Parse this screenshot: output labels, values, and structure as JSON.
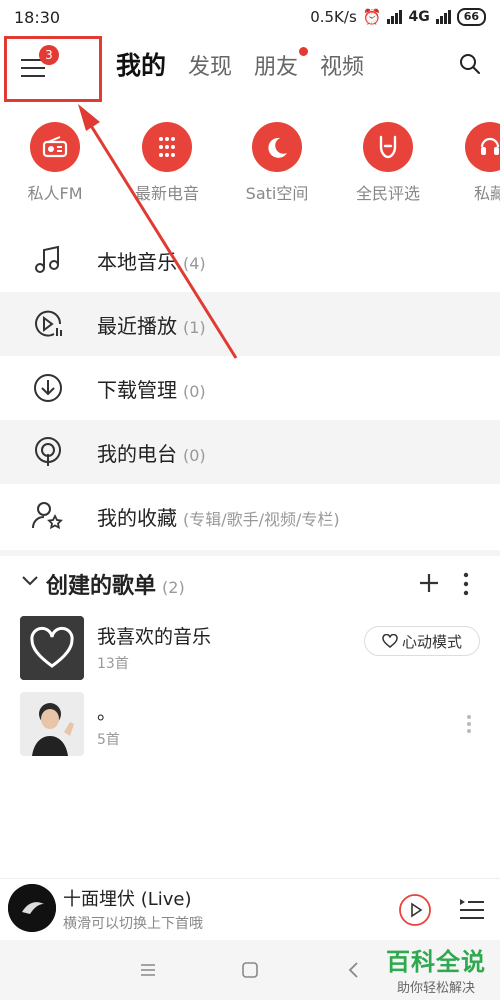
{
  "status": {
    "time": "18:30",
    "speed": "0.5K/s",
    "network": "4G",
    "battery": "66"
  },
  "nav": {
    "badge": "3",
    "tabs": [
      "我的",
      "发现",
      "朋友",
      "视频"
    ]
  },
  "quick": [
    {
      "label": "私人FM",
      "icon": "radio-icon"
    },
    {
      "label": "最新电音",
      "icon": "dots-grid-icon"
    },
    {
      "label": "Sati空间",
      "icon": "moon-icon"
    },
    {
      "label": "全民评选",
      "icon": "rock-hand-icon"
    },
    {
      "label": "私藏",
      "icon": "private-collection-icon"
    }
  ],
  "list": [
    {
      "label": "本地音乐",
      "count": "(4)",
      "icon": "music-note-icon"
    },
    {
      "label": "最近播放",
      "count": "(1)",
      "icon": "recent-play-icon"
    },
    {
      "label": "下载管理",
      "count": "(0)",
      "icon": "download-icon"
    },
    {
      "label": "我的电台",
      "count": "(0)",
      "icon": "podcast-icon"
    },
    {
      "label": "我的收藏",
      "count": "(专辑/歌手/视频/专栏)",
      "icon": "favorite-user-icon"
    }
  ],
  "section": {
    "title": "创建的歌单",
    "count": "(2)"
  },
  "playlists": [
    {
      "name": "我喜欢的音乐",
      "count": "13首",
      "mode_label": "心动模式"
    },
    {
      "name": "。",
      "count": "5首"
    }
  ],
  "player": {
    "title": "十面埋伏 (Live)",
    "subtitle": "横滑可以切换上下首哦"
  },
  "watermark": {
    "title": "百科全说",
    "subtitle": "助你轻松解决"
  },
  "colors": {
    "accent": "#e8433a",
    "watermark": "#2fa84f"
  }
}
